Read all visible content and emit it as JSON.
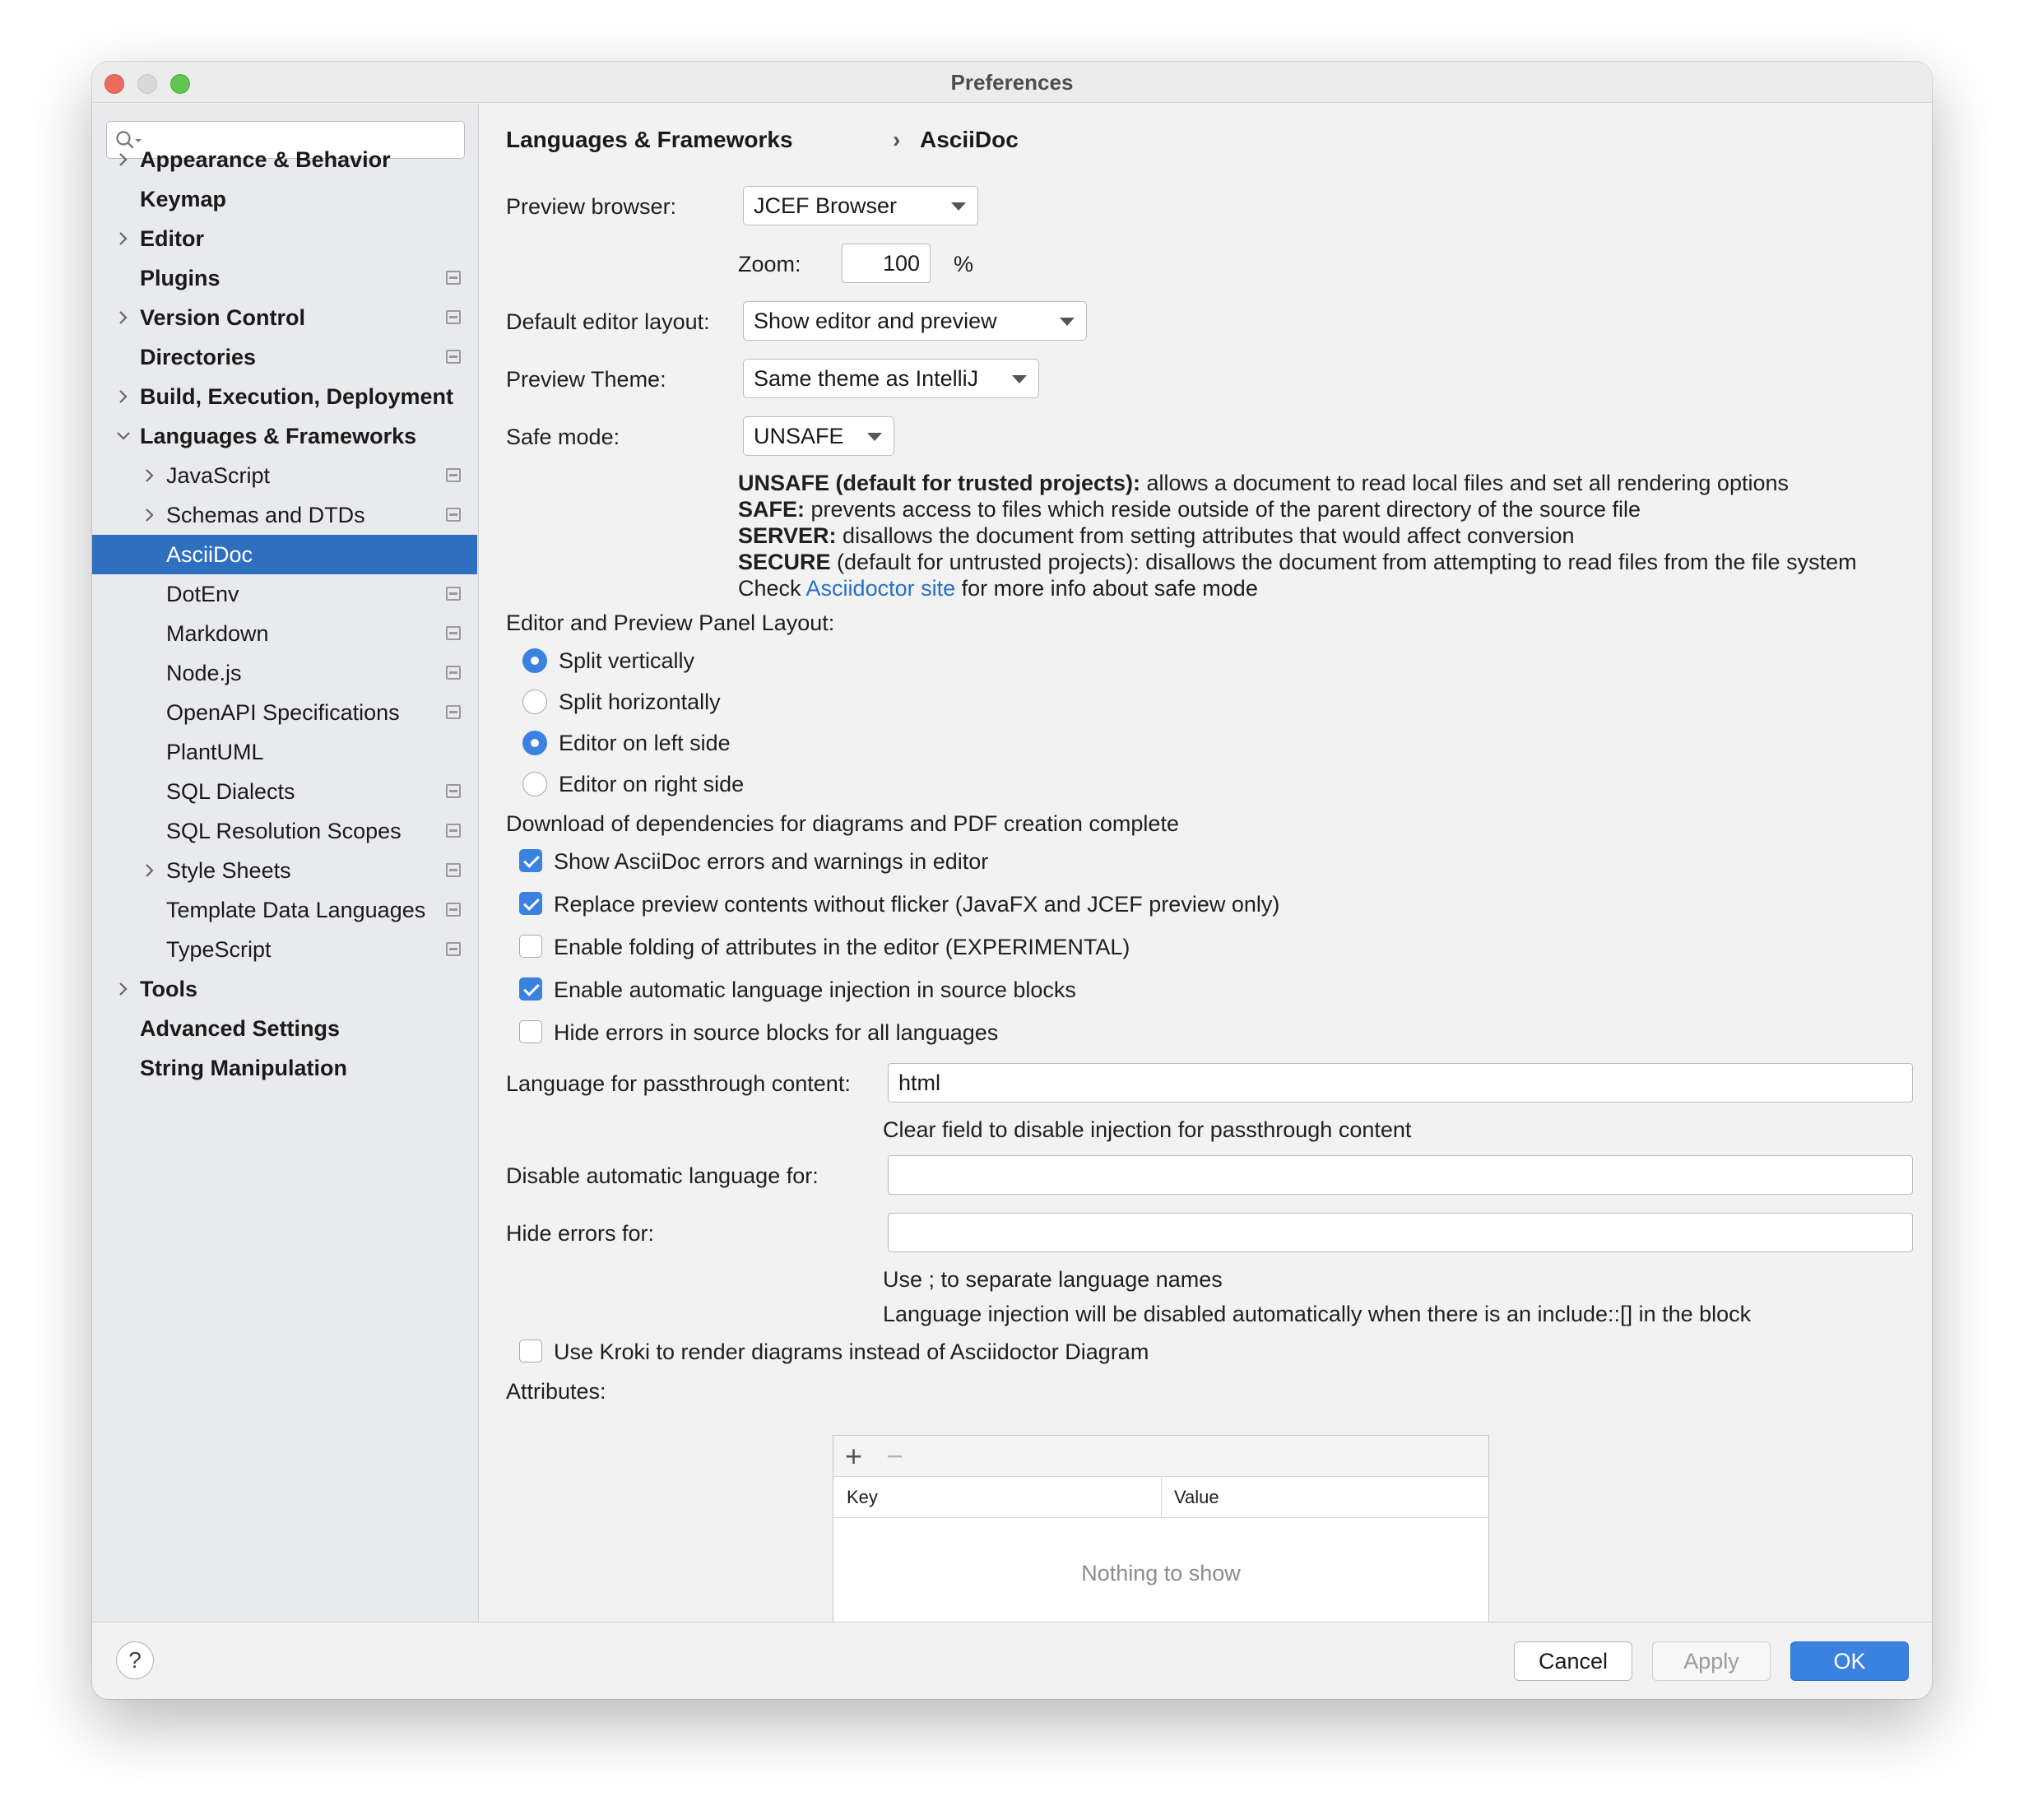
{
  "window": {
    "title": "Preferences"
  },
  "sidebar": {
    "search_placeholder": "",
    "items": [
      {
        "label": "Appearance & Behavior"
      },
      {
        "label": "Keymap"
      },
      {
        "label": "Editor"
      },
      {
        "label": "Plugins"
      },
      {
        "label": "Version Control"
      },
      {
        "label": "Directories"
      },
      {
        "label": "Build, Execution, Deployment"
      },
      {
        "label": "Languages & Frameworks"
      },
      {
        "label": "JavaScript"
      },
      {
        "label": "Schemas and DTDs"
      },
      {
        "label": "AsciiDoc"
      },
      {
        "label": "DotEnv"
      },
      {
        "label": "Markdown"
      },
      {
        "label": "Node.js"
      },
      {
        "label": "OpenAPI Specifications"
      },
      {
        "label": "PlantUML"
      },
      {
        "label": "SQL Dialects"
      },
      {
        "label": "SQL Resolution Scopes"
      },
      {
        "label": "Style Sheets"
      },
      {
        "label": "Template Data Languages"
      },
      {
        "label": "TypeScript"
      },
      {
        "label": "Tools"
      },
      {
        "label": "Advanced Settings"
      },
      {
        "label": "String Manipulation"
      }
    ]
  },
  "breadcrumb": {
    "parent": "Languages & Frameworks",
    "separator": "›",
    "current": "AsciiDoc"
  },
  "nav": {
    "back": "←",
    "forward": "→"
  },
  "form": {
    "preview_browser_label": "Preview browser:",
    "preview_browser_value": "JCEF Browser",
    "zoom_label": "Zoom:",
    "zoom_value": "100",
    "zoom_unit": "%",
    "default_layout_label": "Default editor layout:",
    "default_layout_value": "Show editor and preview",
    "preview_theme_label": "Preview Theme:",
    "preview_theme_value": "Same theme as IntelliJ",
    "safe_mode_label": "Safe mode:",
    "safe_mode_value": "UNSAFE",
    "safe_desc": {
      "unsafe_key": "UNSAFE (default for trusted projects):",
      "unsafe_text": " allows a document to read local files and set all rendering options",
      "safe_key": "SAFE:",
      "safe_text": " prevents access to files which reside outside of the parent directory of the source file",
      "server_key": "SERVER:",
      "server_text": " disallows the document from setting attributes that would affect conversion",
      "secure_key": "SECURE",
      "secure_text": " (default for untrusted projects): disallows the document from attempting to read files from the file system",
      "check_pre": "Check ",
      "check_link": "Asciidoctor site",
      "check_post": " for more info about safe mode"
    },
    "panel_layout_label": "Editor and Preview Panel Layout:",
    "radios": [
      {
        "label": "Split vertically"
      },
      {
        "label": "Split horizontally"
      },
      {
        "label": "Editor on left side"
      },
      {
        "label": "Editor on right side"
      }
    ],
    "download_status": "Download of dependencies for diagrams and PDF creation complete",
    "checkboxes": [
      {
        "label": "Show AsciiDoc errors and warnings in editor"
      },
      {
        "label": "Replace preview contents without flicker (JavaFX and JCEF preview only)"
      },
      {
        "label": "Enable folding of attributes in the editor (EXPERIMENTAL)"
      },
      {
        "label": "Enable automatic language injection in source blocks"
      },
      {
        "label": "Hide errors in source blocks for all languages"
      }
    ],
    "passthrough_label": "Language for passthrough content:",
    "passthrough_value": "html",
    "passthrough_hint": "Clear field to disable injection for passthrough content",
    "disable_auto_label": "Disable automatic language for:",
    "disable_auto_value": "",
    "hide_errors_label": "Hide errors for:",
    "hide_errors_value": "",
    "separator_hint": "Use ; to separate language names",
    "include_hint": "Language injection will be disabled automatically when there is an include::[] in the block",
    "kroki_label": "Use Kroki to render diagrams instead of Asciidoctor Diagram",
    "attributes_label": "Attributes:",
    "table": {
      "add": "+",
      "remove": "−",
      "col_key": "Key",
      "col_value": "Value",
      "empty": "Nothing to show"
    }
  },
  "footer": {
    "help": "?",
    "cancel": "Cancel",
    "apply": "Apply",
    "ok": "OK"
  },
  "colors": {
    "accent": "#3b82e0",
    "selection": "#2f6fc0",
    "link": "#2470c6"
  }
}
